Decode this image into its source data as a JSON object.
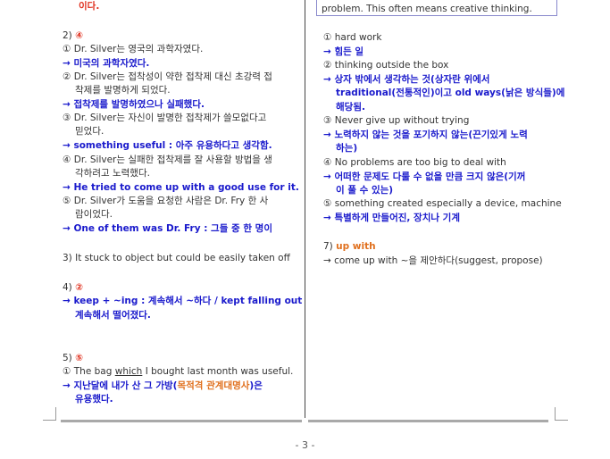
{
  "left": {
    "top_fragment": "이다.",
    "q2": {
      "number": "2)",
      "answer": "④",
      "items": [
        {
          "num": "①",
          "text": "Dr. Silver는 영국의 과학자였다.",
          "translation": "→ 미국의 과학자였다."
        },
        {
          "num": "②",
          "line1": "Dr. Silver는 접착성이 약한 접착제 대신 초강력 접",
          "line2": "착제를 발명하게 되었다.",
          "translation": "→ 접착제를 발명하였으나 실패했다."
        },
        {
          "num": "③",
          "line1": "Dr. Silver는 자신이 발명한 접착제가 쓸모없다고",
          "line2": "믿었다.",
          "translation": "→ something useful : 아주 유용하다고 생각함."
        },
        {
          "num": "④",
          "line1": "Dr. Silver는 실패한 접착제를 잘 사용할 방법을 생",
          "line2": "각하려고 노력했다.",
          "translation": "→ He tried to come up with a good use for it."
        },
        {
          "num": "⑤",
          "line1": "Dr. Silver가 도움을 요청한 사람은 Dr. Fry 한 사",
          "line2": "람이었다.",
          "translation": "→ One of them was Dr. Fry : 그들 중 한 명이"
        }
      ]
    },
    "q3": {
      "number": "3)",
      "text": "It stuck to object but could be easily taken off"
    },
    "q4": {
      "number": "4)",
      "answer": "②",
      "line1": "→ keep + ~ing : 계속해서 ~하다 / kept falling out",
      "line2": "계속해서 떨어졌다."
    },
    "q5": {
      "number": "5)",
      "answer": "⑤",
      "num": "①",
      "sentence_pre": "The bag",
      "sentence_underlined": "which",
      "sentence_post": "I bought last month was useful.",
      "trans_pre": "→ 지난달에 내가 산 그 가방(",
      "trans_highlight": "목적격 관계대명사",
      "trans_post": ")은",
      "trans_line2": "유용했다."
    }
  },
  "right": {
    "box_text": "problem. This often means creative thinking.",
    "items": [
      {
        "num": "①",
        "text": "hard work",
        "translation": "→ 힘든 일"
      },
      {
        "num": "②",
        "text": "thinking outside the box",
        "translation_line1": "→ 상자 밖에서 생각하는 것(상자란 위에서",
        "translation_line2": "traditional(전통적인)이고 old ways(낡은 방식들)에",
        "translation_line3": "해당됨."
      },
      {
        "num": "③",
        "text": "Never give up without trying",
        "translation_line1": "→ 노력하지 않는 것을 포기하지 않는(끈기있게 노력",
        "translation_line2": "하는)"
      },
      {
        "num": "④",
        "text": "No problems are too big to deal with",
        "translation_line1": "→ 어떠한 문제도 다룰 수 없을 만큼 크지 않은(기꺼",
        "translation_line2": "이 풀 수 있는)"
      },
      {
        "num": "⑤",
        "text": "something created especially a device, machine",
        "translation": "→ 특별하게 만들어진, 장치나 기계"
      }
    ],
    "q7": {
      "number": "7)",
      "answer": "up with",
      "explanation": "→ come up with ~을 제안하다(suggest, propose)"
    }
  },
  "footer": {
    "page_number": "- 3 -"
  }
}
